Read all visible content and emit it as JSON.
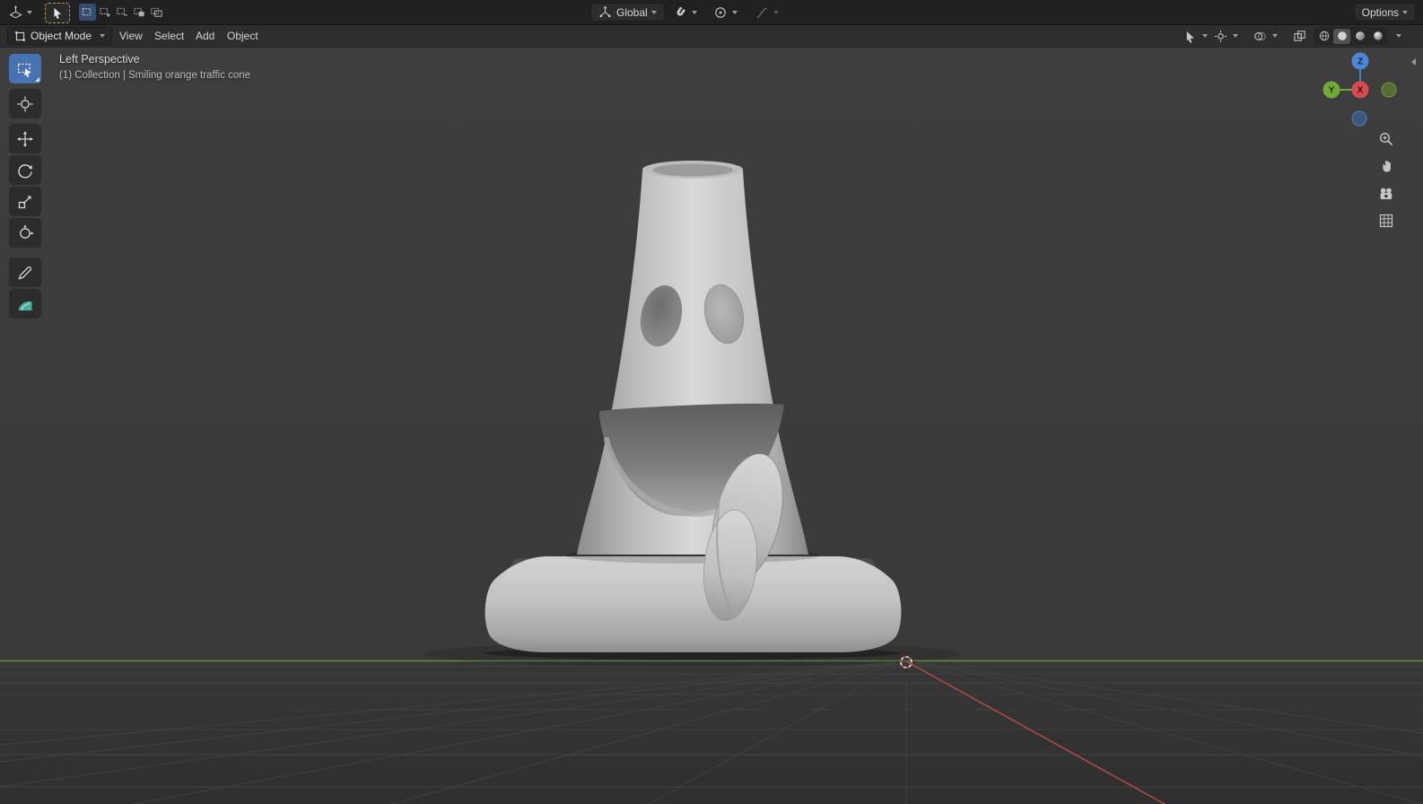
{
  "topbar": {
    "options_label": "Options",
    "orientation": {
      "label": "Global"
    },
    "select_modes": [
      "new",
      "extend",
      "subtract",
      "invert",
      "intersect"
    ]
  },
  "header": {
    "mode": {
      "label": "Object Mode"
    },
    "menus": [
      {
        "label": "View"
      },
      {
        "label": "Select"
      },
      {
        "label": "Add"
      },
      {
        "label": "Object"
      }
    ],
    "shading": {
      "active": "solid",
      "modes": [
        "wireframe",
        "solid",
        "material-preview",
        "rendered"
      ]
    }
  },
  "toolbar": {
    "tools": [
      "select-box",
      "cursor",
      "move",
      "rotate",
      "scale",
      "transform",
      "annotate",
      "measure"
    ],
    "active_tool": "select-box"
  },
  "viewport": {
    "view_label": "Left Perspective",
    "collection_info": "(1) Collection | Smiling orange traffic cone",
    "gizmo": {
      "x": "X",
      "y": "Y",
      "z": "Z"
    },
    "colors": {
      "accent": "#4772b3",
      "axis_x": "#d54c50",
      "axis_y": "#71a836",
      "axis_z": "#4f87d7"
    }
  }
}
